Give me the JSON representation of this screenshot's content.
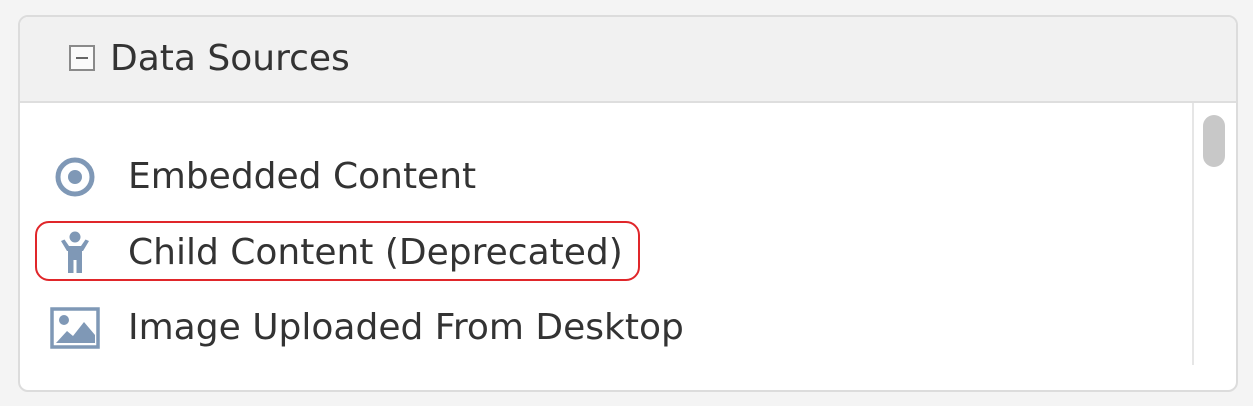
{
  "panel": {
    "title": "Data Sources",
    "toggle_state": "expanded"
  },
  "items": [
    {
      "label": "Embedded Content",
      "icon": "target-icon"
    },
    {
      "label": "Child Content (Deprecated)",
      "icon": "child-person-icon",
      "highlighted": true
    },
    {
      "label": "Image Uploaded From Desktop",
      "icon": "image-icon"
    }
  ],
  "colors": {
    "icon": "#7f98b6",
    "highlight_border": "#e0262a",
    "header_bg": "#f1f1f1"
  }
}
